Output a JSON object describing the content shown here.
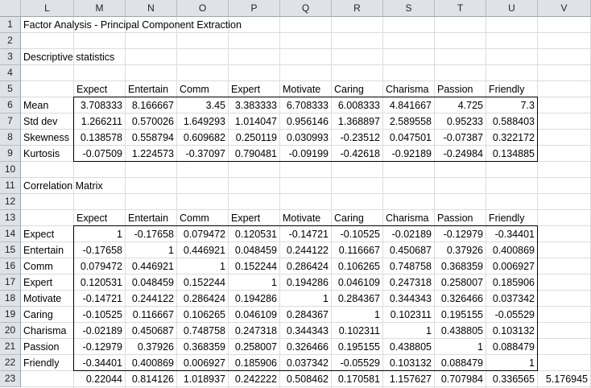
{
  "columns": [
    "L",
    "M",
    "N",
    "O",
    "P",
    "Q",
    "R",
    "S",
    "T",
    "U",
    "V"
  ],
  "rows": [
    "1",
    "2",
    "3",
    "4",
    "5",
    "6",
    "7",
    "8",
    "9",
    "10",
    "11",
    "12",
    "13",
    "14",
    "15",
    "16",
    "17",
    "18",
    "19",
    "20",
    "21",
    "22",
    "23"
  ],
  "title": "Factor Analysis - Principal Component Extraction",
  "descriptive": {
    "label": "Descriptive statistics",
    "headers": [
      "Expect",
      "Entertain",
      "Comm",
      "Expert",
      "Motivate",
      "Caring",
      "Charisma",
      "Passion",
      "Friendly"
    ],
    "rows": [
      {
        "label": "Mean",
        "values": [
          "3.708333",
          "8.166667",
          "3.45",
          "3.383333",
          "6.708333",
          "6.008333",
          "4.841667",
          "4.725",
          "7.3"
        ]
      },
      {
        "label": "Std dev",
        "values": [
          "1.266211",
          "0.570026",
          "1.649293",
          "1.014047",
          "0.956146",
          "1.368897",
          "2.589558",
          "0.95233",
          "0.588403"
        ]
      },
      {
        "label": "Skewness",
        "values": [
          "0.138578",
          "0.558794",
          "0.609682",
          "0.250119",
          "0.030993",
          "-0.23512",
          "0.047501",
          "-0.07387",
          "0.322172"
        ]
      },
      {
        "label": "Kurtosis",
        "values": [
          "-0.07509",
          "1.224573",
          "-0.37097",
          "0.790481",
          "-0.09199",
          "-0.42618",
          "-0.92189",
          "-0.24984",
          "0.134885"
        ]
      }
    ]
  },
  "correlation": {
    "label": "Correlation Matrix",
    "headers": [
      "Expect",
      "Entertain",
      "Comm",
      "Expert",
      "Motivate",
      "Caring",
      "Charisma",
      "Passion",
      "Friendly"
    ],
    "rows": [
      {
        "label": "Expect",
        "values": [
          "1",
          "-0.17658",
          "0.079472",
          "0.120531",
          "-0.14721",
          "-0.10525",
          "-0.02189",
          "-0.12979",
          "-0.34401"
        ]
      },
      {
        "label": "Entertain",
        "values": [
          "-0.17658",
          "1",
          "0.446921",
          "0.048459",
          "0.244122",
          "0.116667",
          "0.450687",
          "0.37926",
          "0.400869"
        ]
      },
      {
        "label": "Comm",
        "values": [
          "0.079472",
          "0.446921",
          "1",
          "0.152244",
          "0.286424",
          "0.106265",
          "0.748758",
          "0.368359",
          "0.006927"
        ]
      },
      {
        "label": "Expert",
        "values": [
          "0.120531",
          "0.048459",
          "0.152244",
          "1",
          "0.194286",
          "0.046109",
          "0.247318",
          "0.258007",
          "0.185906"
        ]
      },
      {
        "label": "Motivate",
        "values": [
          "-0.14721",
          "0.244122",
          "0.286424",
          "0.194286",
          "1",
          "0.284367",
          "0.344343",
          "0.326466",
          "0.037342"
        ]
      },
      {
        "label": "Caring",
        "values": [
          "-0.10525",
          "0.116667",
          "0.106265",
          "0.046109",
          "0.284367",
          "1",
          "0.102311",
          "0.195155",
          "-0.05529"
        ]
      },
      {
        "label": "Charisma",
        "values": [
          "-0.02189",
          "0.450687",
          "0.748758",
          "0.247318",
          "0.344343",
          "0.102311",
          "1",
          "0.438805",
          "0.103132"
        ]
      },
      {
        "label": "Passion",
        "values": [
          "-0.12979",
          "0.37926",
          "0.368359",
          "0.258007",
          "0.326466",
          "0.195155",
          "0.438805",
          "1",
          "0.088479"
        ]
      },
      {
        "label": "Friendly",
        "values": [
          "-0.34401",
          "0.400869",
          "0.006927",
          "0.185906",
          "0.037342",
          "-0.05529",
          "0.103132",
          "0.088479",
          "1"
        ]
      }
    ],
    "totals": [
      "0.22044",
      "0.814126",
      "1.018937",
      "0.242222",
      "0.508462",
      "0.170581",
      "1.157627",
      "0.707984",
      "0.336565",
      "5.176945"
    ]
  }
}
